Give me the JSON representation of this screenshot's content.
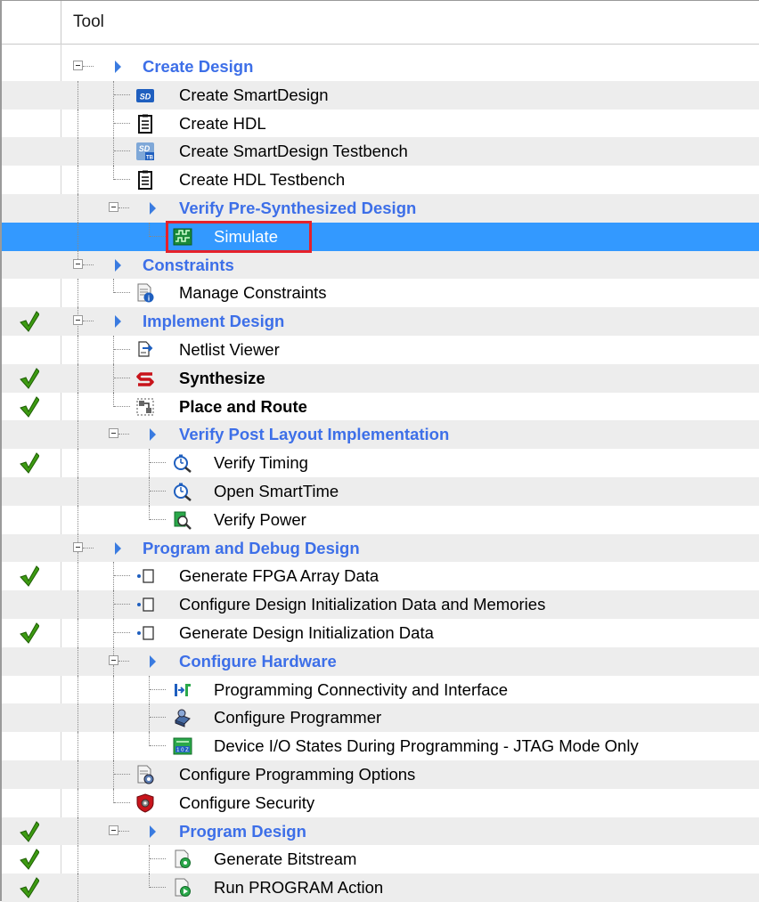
{
  "header": {
    "tool_col": "Tool"
  },
  "colors": {
    "group_blue": "#3d6fe8",
    "selected_bg": "#3399ff",
    "check_green": "#3d9b12",
    "highlight_red": "#e5212b"
  },
  "rows": [
    {
      "label": "Create Design",
      "kind": "group",
      "check": false
    },
    {
      "label": "Create SmartDesign",
      "icon": "smartdesign-icon",
      "check": false
    },
    {
      "label": "Create HDL",
      "icon": "clipboard-icon",
      "check": false
    },
    {
      "label": "Create SmartDesign Testbench",
      "icon": "smartdesign-testbench-icon",
      "check": false
    },
    {
      "label": "Create HDL Testbench",
      "icon": "clipboard-icon",
      "check": false
    },
    {
      "label": "Verify Pre-Synthesized Design",
      "kind": "group",
      "check": false
    },
    {
      "label": "Simulate",
      "icon": "waveform-icon",
      "check": false,
      "selected": true
    },
    {
      "label": "Constraints",
      "kind": "group",
      "check": false
    },
    {
      "label": "Manage Constraints",
      "icon": "document-info-icon",
      "check": false
    },
    {
      "label": "Implement Design",
      "kind": "group",
      "check": true
    },
    {
      "label": "Netlist Viewer",
      "icon": "netlist-icon",
      "check": false
    },
    {
      "label": "Synthesize",
      "icon": "synthesize-icon",
      "check": true,
      "bold": true
    },
    {
      "label": "Place and Route",
      "icon": "place-route-icon",
      "check": true,
      "bold": true
    },
    {
      "label": "Verify Post Layout Implementation",
      "kind": "group",
      "check": false
    },
    {
      "label": "Verify Timing",
      "icon": "timing-magnifier-icon",
      "check": true
    },
    {
      "label": "Open SmartTime",
      "icon": "timing-magnifier-icon",
      "check": false
    },
    {
      "label": "Verify Power",
      "icon": "power-magnifier-icon",
      "check": false
    },
    {
      "label": "Program and Debug Design",
      "kind": "group",
      "check": false
    },
    {
      "label": "Generate FPGA Array Data",
      "icon": "bullet-checkbox-icon",
      "check": true
    },
    {
      "label": "Configure Design Initialization Data and Memories",
      "icon": "bullet-checkbox-icon",
      "check": false
    },
    {
      "label": "Generate Design Initialization Data",
      "icon": "bullet-checkbox-icon",
      "check": true
    },
    {
      "label": "Configure Hardware",
      "kind": "group",
      "check": false
    },
    {
      "label": "Programming Connectivity and Interface",
      "icon": "connectivity-icon",
      "check": false
    },
    {
      "label": "Configure Programmer",
      "icon": "programmer-icon",
      "check": false
    },
    {
      "label": "Device I/O States During Programming - JTAG Mode Only",
      "icon": "io-states-icon",
      "check": false
    },
    {
      "label": "Configure Programming Options",
      "icon": "programming-options-icon",
      "check": false
    },
    {
      "label": "Configure Security",
      "icon": "security-shield-icon",
      "check": false
    },
    {
      "label": "Program Design",
      "kind": "group",
      "check": true
    },
    {
      "label": "Generate Bitstream",
      "icon": "bitstream-icon",
      "check": true
    },
    {
      "label": "Run PROGRAM Action",
      "icon": "run-program-icon",
      "check": true
    }
  ]
}
